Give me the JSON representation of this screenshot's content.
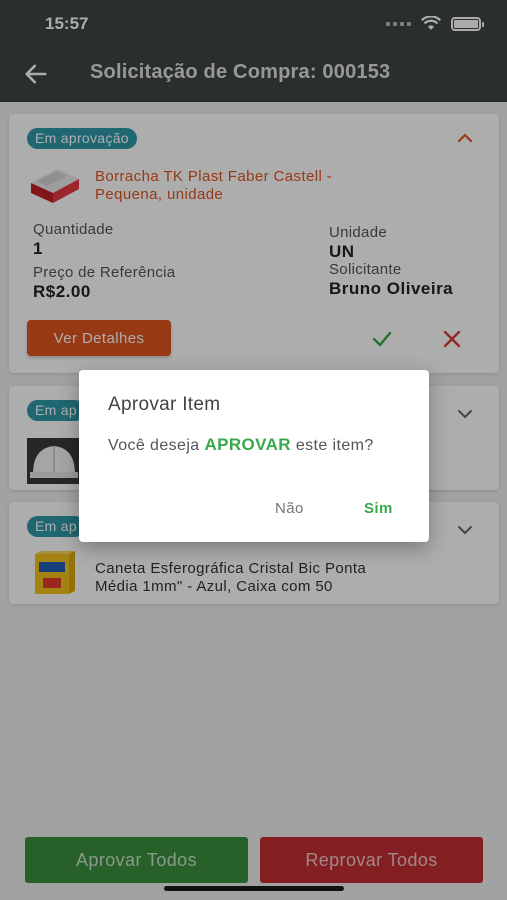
{
  "status_bar": {
    "time": "15:57"
  },
  "app_bar": {
    "title": "Solicitação de Compra: 000153"
  },
  "items": [
    {
      "status": "Em aprovação",
      "name": "Borracha TK Plast Faber Castell - Pequena, unidade",
      "name_line1": "Borracha TK Plast Faber Castell -",
      "name_line2": "Pequena, unidade",
      "quantidade_label": "Quantidade",
      "quantidade": "1",
      "unidade_label": "Unidade",
      "unidade": "UN",
      "preco_label": "Preço de Referência",
      "preco": "R$2.00",
      "solicitante_label": "Solicitante",
      "solicitante": "Bruno Oliveira",
      "details_button": "Ver Detalhes"
    },
    {
      "status": "Em ap"
    },
    {
      "status": "Em ap",
      "name_line1": "Caneta Esferográfica Cristal Bic Ponta",
      "name_line2": "Média 1mm\" - Azul, Caixa com 50"
    }
  ],
  "dialog": {
    "title": "Aprovar Item",
    "message_before": "Você deseja ",
    "message_highlight": "APROVAR",
    "message_after": " este item?",
    "no_label": "Não",
    "yes_label": "Sim"
  },
  "footer": {
    "approve_all": "Aprovar Todos",
    "reject_all": "Reprovar Todos"
  },
  "colors": {
    "header": "#3f4544",
    "accent_orange": "#e0541f",
    "approve_green": "#3aa84a",
    "reject_red": "#c22f33",
    "badge": "#2f9aa8"
  }
}
